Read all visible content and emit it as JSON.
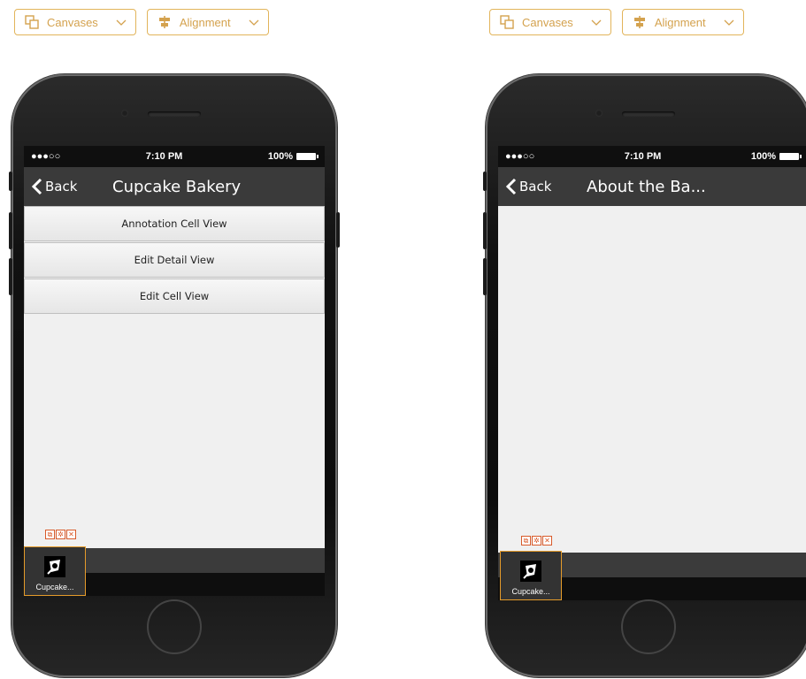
{
  "toolbar": {
    "canvases_label": "Canvases",
    "alignment_label": "Alignment"
  },
  "phones": [
    {
      "status": {
        "carrier": "●●●○○",
        "time": "7:10 PM",
        "battery": "100%"
      },
      "nav": {
        "back": "Back",
        "title": "Cupcake Bakery"
      },
      "list": [
        "Annotation Cell View",
        "Edit Detail View",
        "Edit Cell View"
      ],
      "widget_label": "Cupcake..."
    },
    {
      "status": {
        "carrier": "●●●○○",
        "time": "7:10 PM",
        "battery": "100%"
      },
      "nav": {
        "back": "Back",
        "title": "About the Ba..."
      },
      "list": [],
      "widget_label": "Cupcake..."
    }
  ],
  "colors": {
    "accent": "#e2b45a",
    "widget_border": "#e59b2a",
    "navbar": "#3a3a3a"
  }
}
